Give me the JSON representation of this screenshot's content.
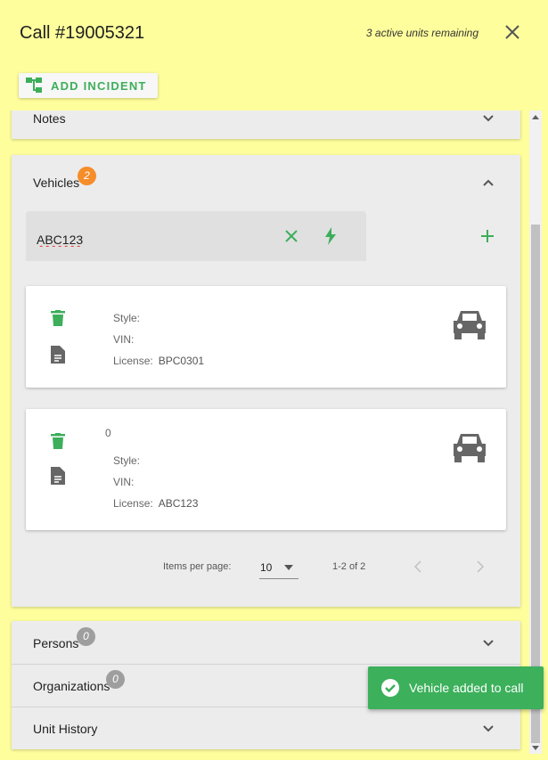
{
  "dialog": {
    "title": "Call #19005321",
    "units_remaining": "3 active units remaining",
    "add_incident_label": "ADD INCIDENT"
  },
  "panels": {
    "notes": {
      "label": "Notes"
    },
    "vehicles": {
      "label": "Vehicles",
      "count": "2",
      "input_value": "ABC123"
    },
    "persons": {
      "label": "Persons",
      "count": "0"
    },
    "organizations": {
      "label": "Organizations",
      "count": "0"
    },
    "unit_history": {
      "label": "Unit History"
    }
  },
  "vehicles": [
    {
      "number": "",
      "style_label": "Style:",
      "style": "",
      "vin_label": "VIN:",
      "vin": "",
      "license_label": "License:",
      "license": "BPC0301"
    },
    {
      "number": "0",
      "style_label": "Style:",
      "style": "",
      "vin_label": "VIN:",
      "vin": "",
      "license_label": "License:",
      "license": "ABC123"
    }
  ],
  "paginator": {
    "items_per_page_label": "Items per page:",
    "page_size": "10",
    "range": "1-2 of 2"
  },
  "snackbar": {
    "message": "Vehicle added to call"
  },
  "colors": {
    "background": "#fefe9c",
    "accent_green": "#3dae5a",
    "badge_orange": "#f58d2a",
    "badge_gray": "#9e9e9e",
    "panel": "#ececec"
  }
}
